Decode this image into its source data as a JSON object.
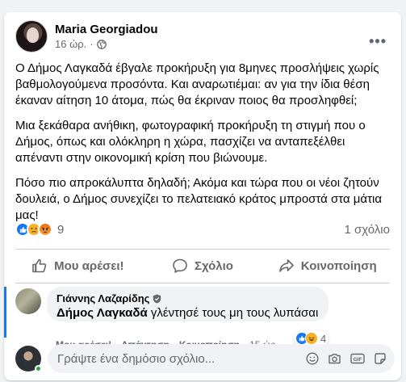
{
  "post": {
    "author": "Maria Georgiadou",
    "time": "16 ώρ.",
    "dot": "·",
    "more": "•••",
    "paragraphs": [
      "Ο Δήμος Λαγκαδά έβγαλε προκήρυξη για 8μηνες προσλήψεις χωρίς βαθμολογούμενα προσόντα. Και αναρωτιέμαι: αν για την ίδια θέση έκαναν αίτηση 10 άτομα, πώς θα έκριναν ποιος θα προσληφθεί;",
      "Μια ξεκάθαρα ανήθικη, φωτογραφική προκήρυξη τη στιγμή που ο Δήμος, όπως και ολόκληρη η χώρα, πασχίζει να ανταπεξέλθει απέναντι στην οικονομική κρίση που βιώνουμε.",
      "Πόσο πιο απροκάλυπτα δηλαδή;  Ακόμα και τώρα που οι νέοι ζητούν δουλειά, ο Δήμος συνεχίζει το πελατειακό κράτος μπροστά στα μάτια μας!"
    ],
    "reactions_count": "9",
    "comments_count": "1 σχόλιο"
  },
  "actions": {
    "like": "Μου αρέσει!",
    "comment": "Σχόλιο",
    "share": "Κοινοποίηση"
  },
  "comment": {
    "author": "Γιάννης Λαζαρίδης",
    "mention": "Δήμος Λαγκαδά",
    "text": " γλέντησέ τους μη τους λυπάσαι",
    "reactions_count": "4",
    "like_link": "Μου αρέσει!",
    "reply_link": "Απάντηση",
    "share_link": "Κοινοποίηση",
    "time": "15 ώρ.",
    "sep": "·"
  },
  "composer": {
    "placeholder": "Γράψτε ένα δημόσιο σχόλιο..."
  },
  "colors": {
    "accent": "#1877f2",
    "secondary_text": "#65676b",
    "online": "#31a24c"
  }
}
